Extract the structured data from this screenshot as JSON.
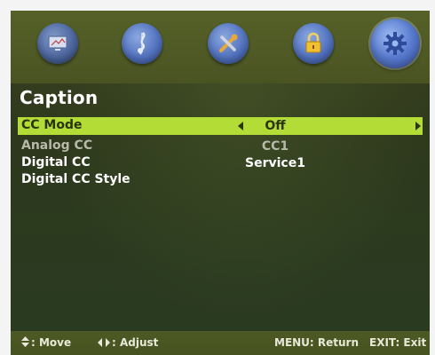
{
  "menu_icons": [
    {
      "name": "picture-icon",
      "selected": false
    },
    {
      "name": "sound-icon",
      "selected": false
    },
    {
      "name": "setup-icon",
      "selected": false
    },
    {
      "name": "lock-icon",
      "selected": false
    },
    {
      "name": "options-gear-icon",
      "selected": true
    }
  ],
  "page": {
    "title": "Caption"
  },
  "items": [
    {
      "label": "CC Mode",
      "value": "Off",
      "state": "selected"
    },
    {
      "label": "Analog CC",
      "value": "CC1",
      "state": "disabled"
    },
    {
      "label": "Digital CC",
      "value": "Service1",
      "state": "normal"
    },
    {
      "label": "Digital CC Style",
      "value": "",
      "state": "normal"
    }
  ],
  "footer": {
    "move": ": Move",
    "adjust": ": Adjust",
    "menu": "MENU: Return",
    "exit": "EXIT: Exit"
  },
  "colors": {
    "highlight": "#b3dc36",
    "background": "#2e381c",
    "bar": "#4e5a25",
    "dim_text": "#b8b8ab"
  }
}
